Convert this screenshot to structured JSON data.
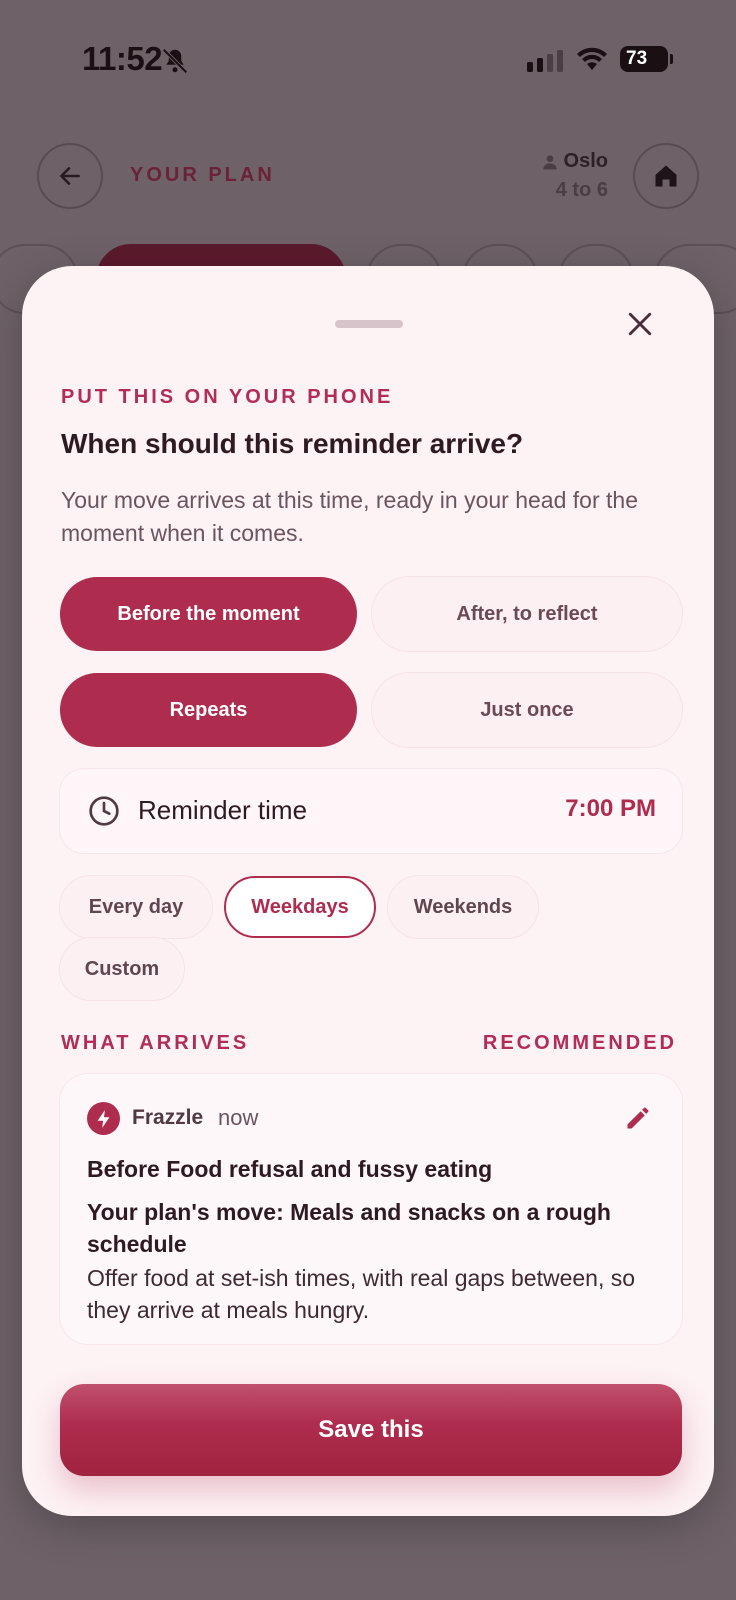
{
  "status_bar": {
    "time": "11:52",
    "battery": "73"
  },
  "header": {
    "title": "YOUR PLAN",
    "location": "Oslo",
    "age_range": "4 to 6"
  },
  "sheet": {
    "eyebrow": "PUT THIS ON YOUR PHONE",
    "title": "When should this reminder arrive?",
    "description": "Your move arrives at this time, ready in your head for the moment when it comes.",
    "timing_options": [
      {
        "label": "Before the moment",
        "selected": true
      },
      {
        "label": "After, to reflect",
        "selected": false
      }
    ],
    "frequency_options": [
      {
        "label": "Repeats",
        "selected": true
      },
      {
        "label": "Just once",
        "selected": false
      }
    ],
    "reminder": {
      "label": "Reminder time",
      "value": "7:00 PM"
    },
    "days": [
      {
        "label": "Every day",
        "selected": false
      },
      {
        "label": "Weekdays",
        "selected": true
      },
      {
        "label": "Weekends",
        "selected": false
      },
      {
        "label": "Custom",
        "selected": false
      }
    ],
    "preview_section": {
      "label": "WHAT ARRIVES",
      "tag": "RECOMMENDED"
    },
    "notification": {
      "app_name": "Frazzle",
      "time": "now",
      "line1": "Before Food refusal and fussy eating",
      "line2": "Your plan's move: Meals and snacks on a rough schedule",
      "line3": "Offer food at set-ish times, with real gaps between, so they arrive at meals hungry."
    },
    "save_label": "Save this"
  },
  "colors": {
    "accent": "#ae2c4e",
    "sheet_bg": "#fdf2f4",
    "scrim": "#6e6268"
  }
}
